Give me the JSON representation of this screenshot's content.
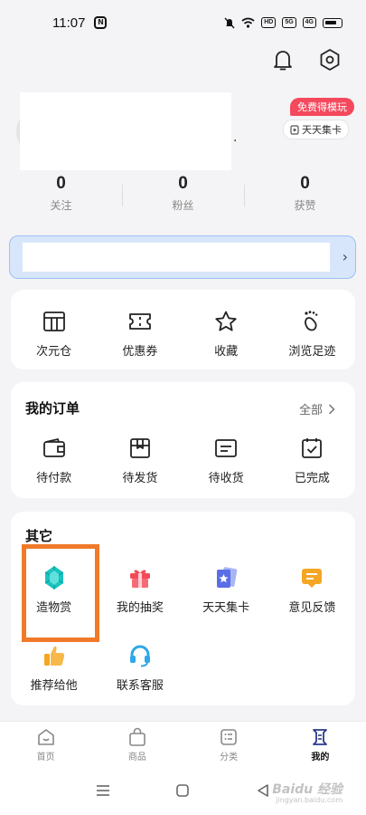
{
  "status_bar": {
    "time": "11:07",
    "app_badge": "N",
    "hd_label": "HD",
    "net1": "5G",
    "net2": "4G"
  },
  "header": {
    "icons": [
      "bell-icon",
      "settings-icon"
    ]
  },
  "profile": {
    "name_suffix": ".",
    "free_badge": "免费得模玩",
    "card_badge": "天天集卡"
  },
  "stats": [
    {
      "value": "0",
      "label": "关注"
    },
    {
      "value": "0",
      "label": "粉丝"
    },
    {
      "value": "0",
      "label": "获赞"
    }
  ],
  "banner": {
    "arrow": "›"
  },
  "quick_actions": [
    {
      "label": "次元仓",
      "icon": "warehouse-icon"
    },
    {
      "label": "优惠券",
      "icon": "coupon-icon"
    },
    {
      "label": "收藏",
      "icon": "star-icon"
    },
    {
      "label": "浏览足迹",
      "icon": "footprint-icon"
    }
  ],
  "orders": {
    "title": "我的订单",
    "more": "全部",
    "items": [
      {
        "label": "待付款",
        "icon": "wallet-icon"
      },
      {
        "label": "待发货",
        "icon": "package-icon"
      },
      {
        "label": "待收货",
        "icon": "receive-icon"
      },
      {
        "label": "已完成",
        "icon": "check-box-icon"
      }
    ]
  },
  "other": {
    "title": "其它",
    "items": [
      {
        "label": "造物赏",
        "icon": "crystal-icon",
        "color": "#19c3c0"
      },
      {
        "label": "我的抽奖",
        "icon": "gift-icon",
        "color": "#f24b57"
      },
      {
        "label": "天天集卡",
        "icon": "cards-icon",
        "color": "#5b6ee8"
      },
      {
        "label": "意见反馈",
        "icon": "feedback-icon",
        "color": "#f5a623"
      },
      {
        "label": "推荐给他",
        "icon": "thumbs-up-icon",
        "color": "#f5a623"
      },
      {
        "label": "联系客服",
        "icon": "headset-icon",
        "color": "#2fa7e8"
      }
    ]
  },
  "tabbar": [
    {
      "label": "首页",
      "icon": "home-icon",
      "active": false
    },
    {
      "label": "商品",
      "icon": "bag-icon",
      "active": false
    },
    {
      "label": "分类",
      "icon": "category-icon",
      "active": false
    },
    {
      "label": "我的",
      "icon": "profile-tab-icon",
      "active": true
    }
  ],
  "watermark": {
    "main": "Baidu 经验",
    "sub": "jingyan.baidu.com"
  },
  "colors": {
    "highlight": "#f07a2a",
    "accent_red": "#f4485c"
  }
}
